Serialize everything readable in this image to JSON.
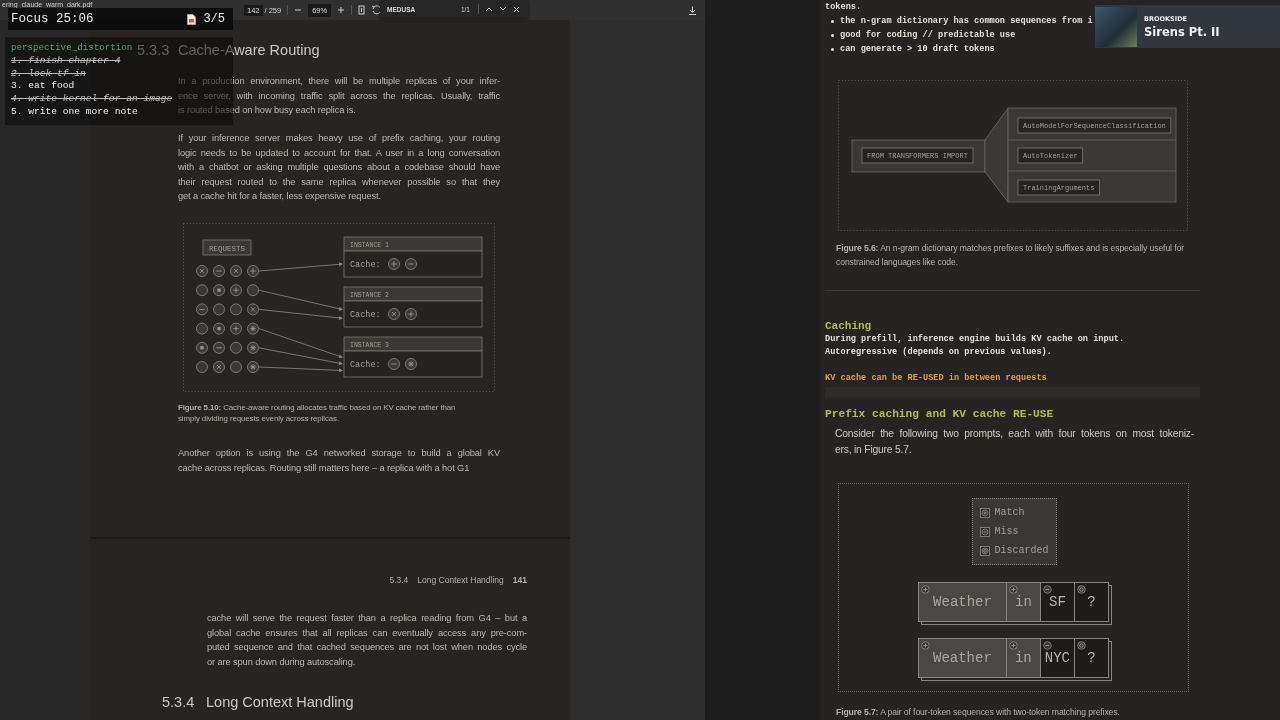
{
  "pdf_viewer": {
    "file_name": "ering_claude_warm_dark.pdf",
    "page_number": "142",
    "page_count": "/ 259",
    "zoom": "69%"
  },
  "find_bar": {
    "query": "MEDUSA",
    "match_count": "1/1"
  },
  "focus_timer": {
    "label": "Focus 25:06",
    "sessions": "3/5"
  },
  "todo": {
    "title": "perspective_distortion",
    "items": [
      {
        "text": "1. finish chapter 4",
        "done": true
      },
      {
        "text": "2. lock tf in",
        "done": true
      },
      {
        "text": "3. eat food",
        "done": false
      },
      {
        "text": "4. write kernel for an image",
        "done": true
      },
      {
        "text": "5. write one more note",
        "done": false
      }
    ]
  },
  "book": {
    "section_heading": {
      "number": "5.3.3",
      "title": "Cache-Aware Routing"
    },
    "paragraphs": [
      {
        "lines": [
          "In a production environment, there will be multiple replicas of your infer-",
          "ence server, with incoming traffic split across the replicas. Usually, traffic",
          "is routed based on how busy each replica is."
        ]
      },
      {
        "lines": [
          "If your inference server makes heavy use of prefix caching, your routing",
          "logic needs to be updated to account for that. A user in a long conversation",
          "with a chatbot or asking multiple questions about a codebase should have",
          "their request routed to the same replica whenever possible so that they",
          "get a cache hit for a faster, less expensive request."
        ]
      }
    ],
    "routing_figure": {
      "requests_label": "REQUESTS",
      "instances": [
        {
          "title": "INSTANCE 1",
          "cache_label": "Cache:",
          "cache": [
            {
              "kind": "plus"
            },
            {
              "kind": "minus"
            }
          ],
          "requests": [
            {
              "cells": [
                {
                  "kind": "x"
                },
                {
                  "kind": "minus"
                },
                {
                  "kind": "x"
                },
                {
                  "kind": "plus"
                }
              ]
            }
          ]
        },
        {
          "title": "INSTANCE 2",
          "cache_label": "Cache:",
          "cache": [
            {
              "kind": "x"
            },
            {
              "kind": "plus"
            }
          ],
          "requests": [
            {
              "cells": [
                {
                  "kind": "none"
                },
                {
                  "kind": "dot"
                },
                {
                  "kind": "plus"
                },
                {
                  "kind": "none"
                }
              ]
            },
            {
              "cells": [
                {
                  "kind": "minus"
                },
                {
                  "kind": "none"
                },
                {
                  "kind": "none"
                },
                {
                  "kind": "x"
                }
              ]
            }
          ]
        },
        {
          "title": "INSTANCE 3",
          "cache_label": "Cache:",
          "cache": [
            {
              "kind": "minus"
            },
            {
              "kind": "star"
            }
          ],
          "requests": [
            {
              "cells": [
                {
                  "kind": "none"
                },
                {
                  "kind": "dot"
                },
                {
                  "kind": "plus"
                },
                {
                  "kind": "star"
                }
              ]
            },
            {
              "cells": [
                {
                  "kind": "dot"
                },
                {
                  "kind": "minus"
                },
                {
                  "kind": "none"
                },
                {
                  "kind": "star"
                }
              ]
            },
            {
              "cells": [
                {
                  "kind": "none"
                },
                {
                  "kind": "x"
                },
                {
                  "kind": "none"
                },
                {
                  "kind": "star"
                }
              ]
            }
          ]
        }
      ]
    },
    "figure_caption": {
      "lines": [
        "**Figure 5.10:** Cache-aware routing allocates traffic based on KV cache rather than",
        "simply dividing requests evenly across replicas."
      ]
    },
    "paragraph_after": {
      "lines": [
        "Another option is using the G4 networked storage to build a global KV",
        "cache across replicas. Routing still matters here – a replica with a hot G1"
      ]
    },
    "running_header": {
      "section": "5.3.4",
      "title": "Long Context Handling",
      "page": "141"
    },
    "continued_paragraph": {
      "lines": [
        "cache will serve the request faster than a replica reading from G4 – but a",
        "global cache ensures that all replicas can eventually access any pre-com-",
        "puted sequence and that cached sequences are not lost when nodes cycle",
        "or are spun down during autoscaling."
      ]
    },
    "next_heading": {
      "number": "5.3.4",
      "title": "Long Context Handling"
    }
  },
  "notes": {
    "intro": "tokens.",
    "bullets": [
      {
        "text": "the n-gram dictionary has common sequences from i"
      },
      {
        "text": "**good for coding** // predictable use"
      },
      {
        "text": "can generate > 10 draft tokens"
      }
    ],
    "ngram_figure": {
      "prefix": "FROM TRANSFORMERS IMPORT",
      "suffixes": [
        "AutoModelForSequenceClassification",
        "AutoTokenizer",
        "TrainingArguments"
      ]
    },
    "ngram_caption": "**Figure 5.6:** An n-gram dictionary matches prefixes to likely suffixes and is especially useful for constrained languages like code.",
    "caching_heading": "Caching",
    "caching_lines": [
      "During prefill, inference engine builds KV cache on input.",
      "Autoregressive (depends on previous values)."
    ],
    "highlight": "KV cache can be RE-USED in between requests",
    "prefix_heading": "Prefix caching and KV cache RE-USE",
    "paragraph": {
      "lines": [
        "Consider the following two prompts, each with four tokens on most tokeniz-",
        "ers, in Figure 5.7."
      ]
    },
    "prefix_figure": {
      "legend": [
        {
          "label": "Match",
          "kind": "match"
        },
        {
          "label": "Miss",
          "kind": "miss"
        },
        {
          "label": "Discarded",
          "kind": "discarded"
        }
      ],
      "sequences": [
        {
          "tokens": [
            {
              "text": "Weather",
              "kind": "match"
            },
            {
              "text": "in",
              "kind": "match"
            },
            {
              "text": "SF",
              "kind": "miss"
            },
            {
              "text": "?",
              "kind": "discarded"
            }
          ]
        },
        {
          "tokens": [
            {
              "text": "Weather",
              "kind": "match"
            },
            {
              "text": "in",
              "kind": "match"
            },
            {
              "text": "NYC",
              "kind": "miss"
            },
            {
              "text": "?",
              "kind": "discarded"
            }
          ]
        }
      ]
    },
    "prefix_caption": "**Figure 5.7:** A pair of four-token sequences with two-token matching prefixes."
  },
  "now_playing": {
    "artist": "BROOKSIDE",
    "track": "Sirens Pt. II"
  }
}
